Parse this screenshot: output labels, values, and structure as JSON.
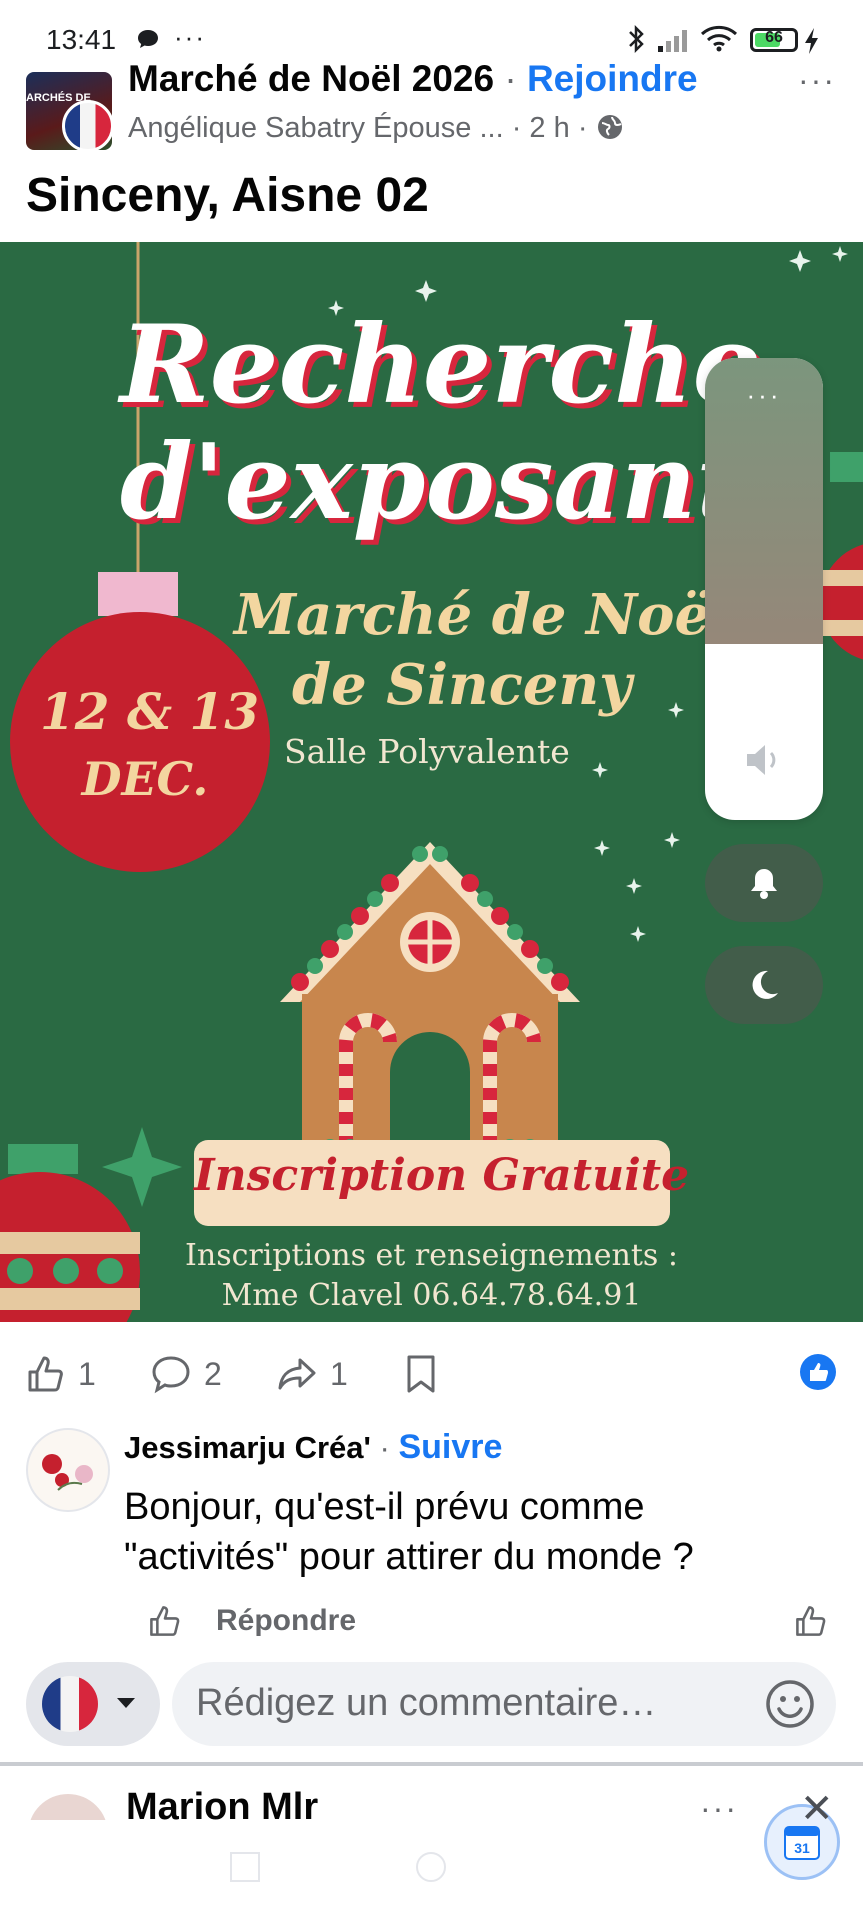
{
  "status_bar": {
    "time": "13:41",
    "dots": "···",
    "battery": "66",
    "battery_level": 0.66
  },
  "post": {
    "group_name": "Marché de Noël 2026",
    "separator": " · ",
    "join_label": "Rejoindre",
    "author": "Angélique Sabatry Épouse ...",
    "time_ago": "2 h",
    "text": "Sinceny, Aisne 02",
    "group_avatar_text": "ARCHÉS DE"
  },
  "poster": {
    "title_line1": "Recherche",
    "title_line2": "d'exposants",
    "market_line1": "Marché de Noël",
    "market_line2": "de Sinceny",
    "venue": "Salle Polyvalente",
    "date_line1": "12 & 13",
    "date_line2": "DEC.",
    "cta": "Inscription Gratuite",
    "contact_line1": "Inscriptions et renseignements :",
    "contact_line2": "Mme Clavel 06.64.78.64.91"
  },
  "volume_overlay": {
    "more": "···",
    "level": 0.38
  },
  "reactions": {
    "likes": "1",
    "comments": "2",
    "shares": "1"
  },
  "comment": {
    "author": "Jessimarju Créa'",
    "separator": " · ",
    "follow_label": "Suivre",
    "text_line1": "Bonjour, qu'est-il prévu comme",
    "text_line2": "\"activités\" pour attirer du monde ?",
    "reply_label": "Répondre"
  },
  "composer": {
    "placeholder": "Rédigez un commentaire…"
  },
  "next_comment": {
    "author": "Marion Mlr",
    "more": "···"
  },
  "calendar_badge": "31",
  "colors": {
    "facebook_blue": "#1877f2",
    "poster_green": "#2a6a43",
    "poster_red": "#d7263d"
  }
}
